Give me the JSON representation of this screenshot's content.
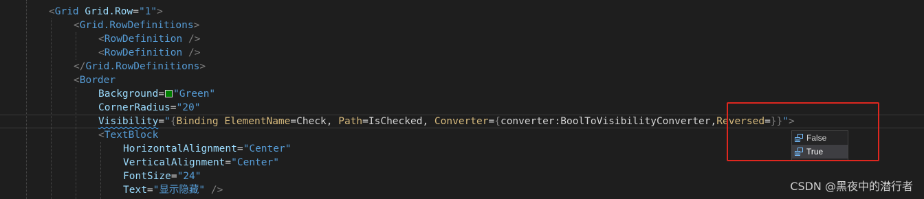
{
  "code": {
    "line1": {
      "open": "<",
      "tag": "Grid",
      "attr": "Grid.Row",
      "eq": "=",
      "value": "\"1\"",
      "close": ">"
    },
    "line2": {
      "open": "<",
      "tag": "Grid.RowDefinitions",
      "close": ">"
    },
    "line3": {
      "open": "<",
      "tag": "RowDefinition",
      "close": " />"
    },
    "line4": {
      "open": "<",
      "tag": "RowDefinition",
      "close": " />"
    },
    "line5": {
      "open": "</",
      "tag": "Grid.RowDefinitions",
      "close": ">"
    },
    "line6": {
      "open": "<",
      "tag": "Border"
    },
    "line7": {
      "attr": "Background",
      "eq": "=",
      "value": "\"Green\""
    },
    "line8": {
      "attr": "CornerRadius",
      "eq": "=",
      "value": "\"20\""
    },
    "line9": {
      "attr": "Visibility",
      "eq": "=",
      "q_open": "\"",
      "b_open": "{",
      "binding": "Binding",
      "k1": "ElementName",
      "e1": "=",
      "v1": "Check, ",
      "k2": "Path",
      "e2": "=",
      "v2": "IsChecked, ",
      "k3": "Converter",
      "e3": "=",
      "c_open": "{",
      "converter": "converter:BoolToVisibilityConverter",
      "comma": ",",
      "k4": "Reversed",
      "e4": "=",
      "b_close": "}}",
      "q_close": "\"",
      "close": ">"
    },
    "line10": {
      "open": "<",
      "tag": "TextBlock"
    },
    "line11": {
      "attr": "HorizontalAlignment",
      "eq": "=",
      "value": "\"Center\""
    },
    "line12": {
      "attr": "VerticalAlignment",
      "eq": "=",
      "value": "\"Center\""
    },
    "line13": {
      "attr": "FontSize",
      "eq": "=",
      "value": "\"24\""
    },
    "line14": {
      "attr": "Text",
      "eq": "=",
      "value": "\"显示隐藏\"",
      "close": " />"
    }
  },
  "background_swatch_color": "#008000",
  "intellisense": {
    "items": [
      {
        "label": "False",
        "icon": "enum-value-icon",
        "selected": false
      },
      {
        "label": "True",
        "icon": "enum-value-icon",
        "selected": true
      }
    ]
  },
  "highlight_color": "#e0271f",
  "watermark": "CSDN @黑夜中的潜行者"
}
